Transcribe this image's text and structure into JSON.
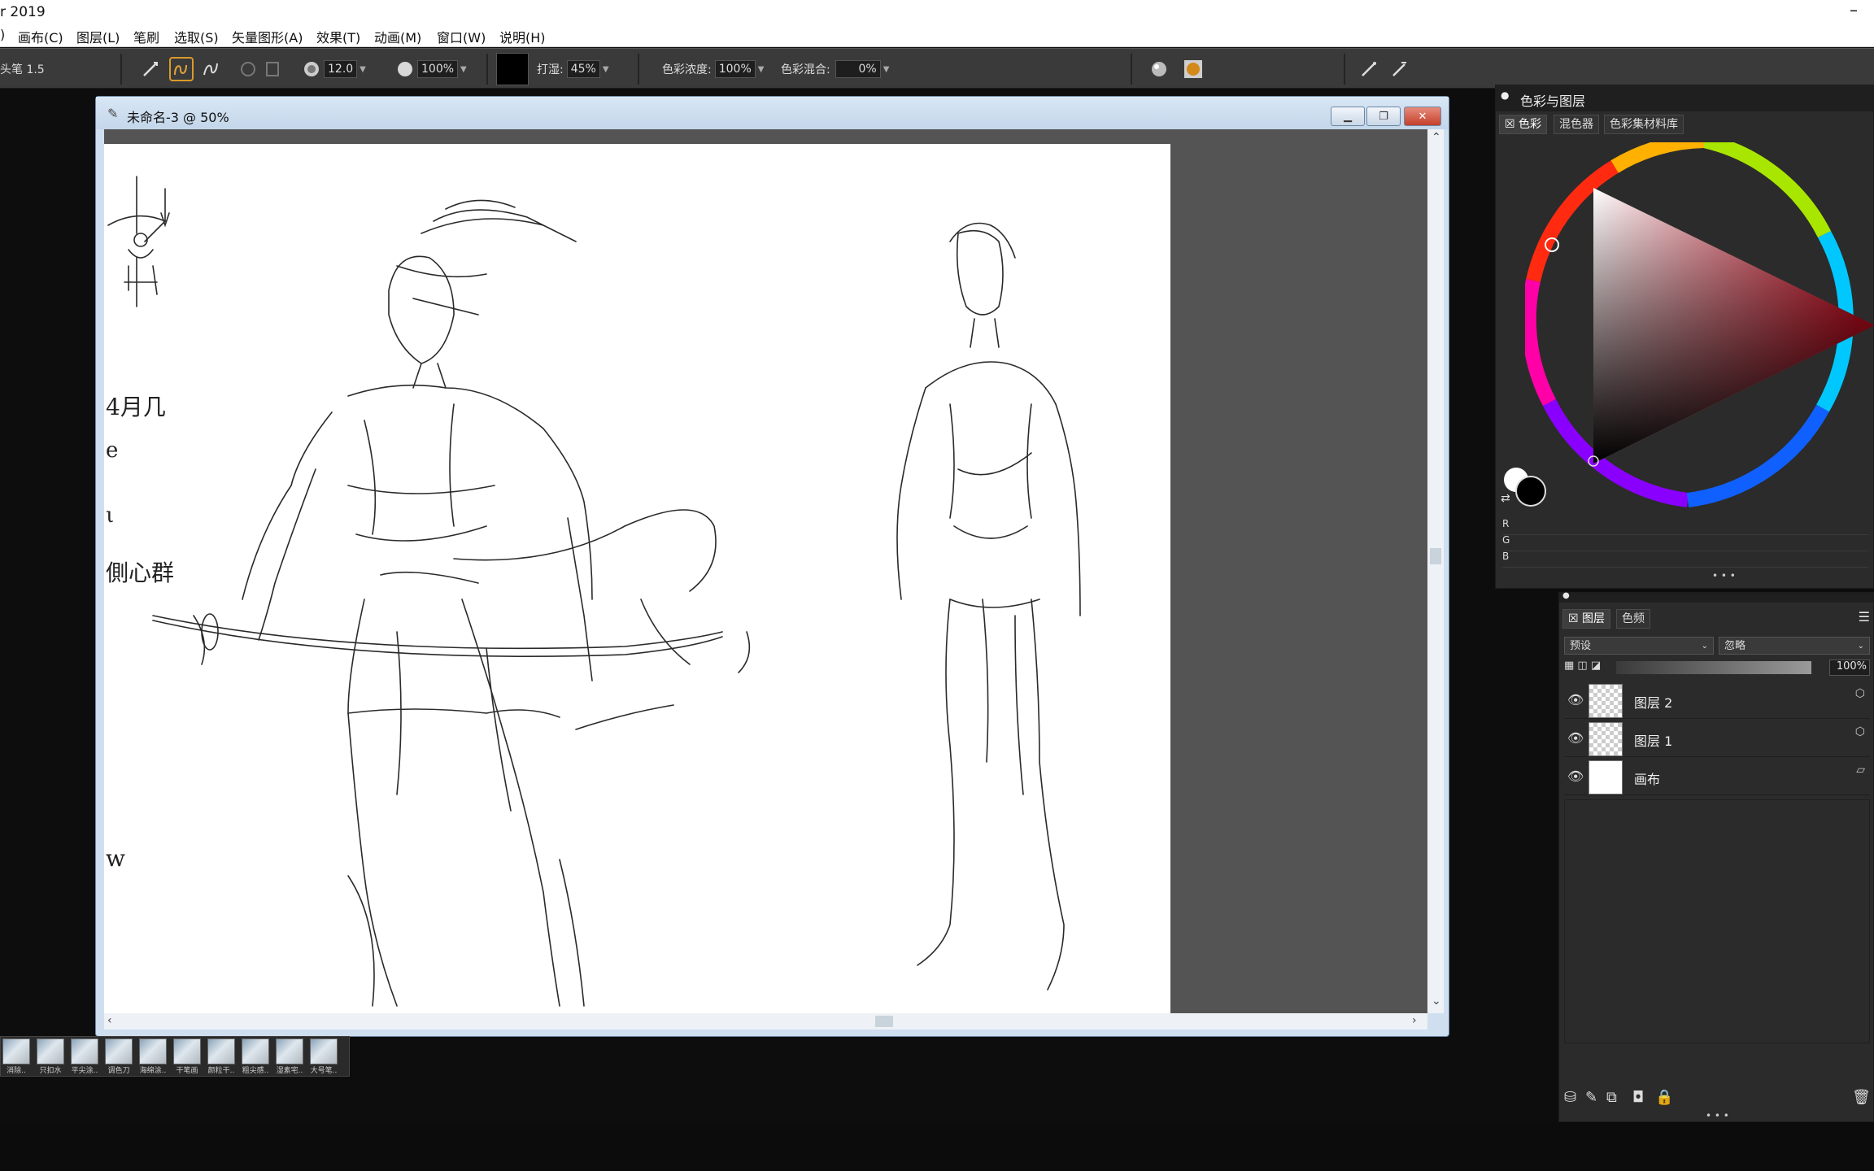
{
  "app": {
    "title": "r 2019",
    "minimize": "–"
  },
  "menu": [
    "画布(C)",
    "图层(L)",
    "笔刷",
    "选取(S)",
    "矢量图形(A)",
    "效果(T)",
    "动画(M)",
    "窗口(W)",
    "说明(H)"
  ],
  "menu_prefix": ")",
  "toolbar": {
    "brush_name": "头笔 1.5",
    "size_value": "12.0",
    "opacity_value": "100%",
    "grain_label": "打湿:",
    "grain_value": "45%",
    "concentration_label": "色彩浓度:",
    "concentration_value": "100%",
    "mix_label": "色彩混合:",
    "mix_value": "0%"
  },
  "document": {
    "title": "未命名-3 @ 50%"
  },
  "sketch_notes": [
    "4月几",
    "e",
    "ι",
    "側心群",
    "w"
  ],
  "brush_strip": {
    "labels": [
      "消除..",
      "只扣水",
      "平尖涂..",
      "调色刀",
      "海绵涂..",
      "干笔画",
      "颜粒干..",
      "粗尖感..",
      "湿素宅..",
      "大号笔.."
    ]
  },
  "color_panel": {
    "title": "色彩与图层",
    "tabs": [
      "色彩",
      "混色器",
      "色彩集材料库"
    ],
    "rgb_labels": [
      "R",
      "G",
      "B"
    ],
    "more": "• • •"
  },
  "layer_panel": {
    "tabs": [
      "图层",
      "色频"
    ],
    "composite_method": "预设",
    "composite_depth": "忽略",
    "opacity": "100%",
    "layers": [
      {
        "name": "图层 2",
        "thumb": "checker"
      },
      {
        "name": "图层 1",
        "thumb": "checker"
      },
      {
        "name": "画布",
        "thumb": "white"
      }
    ],
    "more": "• • •"
  },
  "colors": {
    "accent": "#d99a2b",
    "active_color": "#000000"
  }
}
